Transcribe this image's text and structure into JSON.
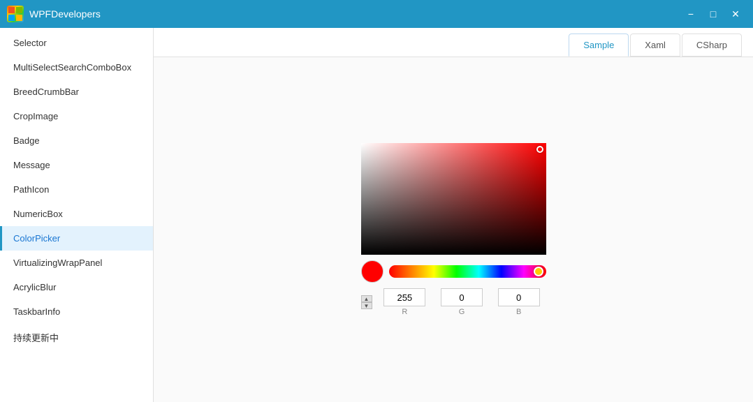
{
  "titlebar": {
    "title": "WPFDevelopers",
    "minimize_label": "−",
    "maximize_label": "□",
    "close_label": "✕"
  },
  "tabs": [
    {
      "id": "sample",
      "label": "Sample",
      "active": true
    },
    {
      "id": "xaml",
      "label": "Xaml",
      "active": false
    },
    {
      "id": "csharp",
      "label": "CSharp",
      "active": false
    }
  ],
  "sidebar": {
    "items": [
      {
        "id": "selector",
        "label": "Selector",
        "active": false
      },
      {
        "id": "multiselect",
        "label": "MultiSelectSearchComboBox",
        "active": false
      },
      {
        "id": "breadcrumb",
        "label": "BreedCrumbBar",
        "active": false
      },
      {
        "id": "cropimage",
        "label": "CropImage",
        "active": false
      },
      {
        "id": "badge",
        "label": "Badge",
        "active": false
      },
      {
        "id": "message",
        "label": "Message",
        "active": false
      },
      {
        "id": "pathicon",
        "label": "PathIcon",
        "active": false
      },
      {
        "id": "numericbox",
        "label": "NumericBox",
        "active": false
      },
      {
        "id": "colorpicker",
        "label": "ColorPicker",
        "active": true
      },
      {
        "id": "virtualizingwrappanel",
        "label": "VirtualizingWrapPanel",
        "active": false
      },
      {
        "id": "acrylicblur",
        "label": "AcrylicBlur",
        "active": false
      },
      {
        "id": "taskbarinfo",
        "label": "TaskbarInfo",
        "active": false
      },
      {
        "id": "updates",
        "label": "持续更新中",
        "active": false
      }
    ]
  },
  "colorpicker": {
    "r_value": "255",
    "g_value": "0",
    "b_value": "0",
    "r_label": "R",
    "g_label": "G",
    "b_label": "B"
  }
}
